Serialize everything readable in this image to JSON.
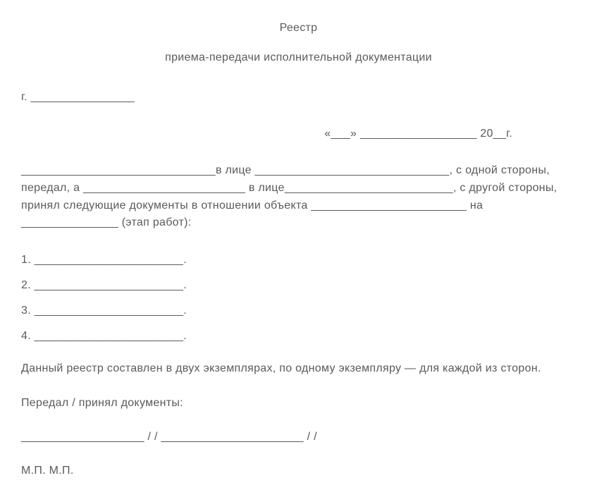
{
  "title": {
    "line1": "Реестр",
    "line2": "приема-передачи исполнительной документации"
  },
  "city_line": "г. ________________",
  "date_line": "«___» __________________ 20__г.",
  "body": "______________________________в лице ______________________________, с одной стороны, передал, а _________________________ в лице__________________________, с другой стороны, принял следующие документы в отношении объекта ________________________ на _______________ (этап работ):",
  "list": {
    "item1": "1. _______________________.",
    "item2": "2. _______________________.",
    "item3": "3. _______________________.",
    "item4": "4. _______________________."
  },
  "copies_text": "Данный реестр составлен в двух экземплярах, по одному экземпляру — для каждой из сторон.",
  "signed_label": "Передал / принял документы:",
  "sign_line": "___________________ / / ______________________ / /",
  "stamp_line": "М.П. М.П."
}
